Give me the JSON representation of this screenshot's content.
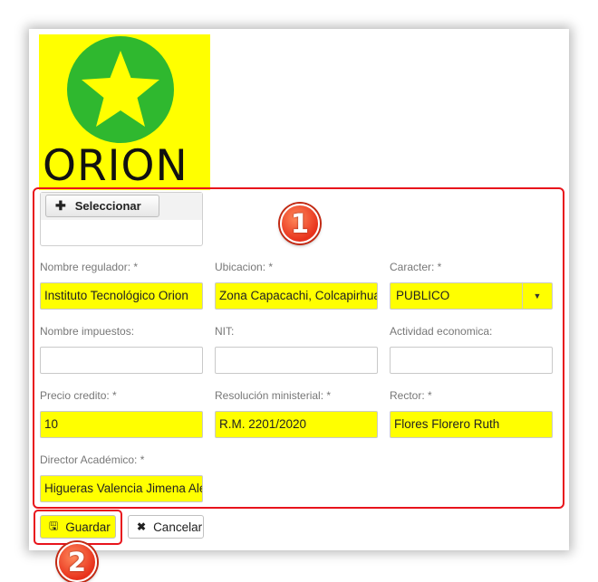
{
  "logo": {
    "text": "ORION",
    "icon": "star-icon",
    "bg_color": "#ffff00",
    "circle_color": "#2fb82f",
    "star_color": "#ffff00"
  },
  "upload": {
    "select_label": "Seleccionar",
    "icon": "plus-icon"
  },
  "annotations": {
    "badge1": "1",
    "badge2": "2",
    "highlight_color": "#e8141c"
  },
  "form": {
    "nombre_regulador": {
      "label": "Nombre regulador: *",
      "value": "Instituto Tecnológico Orion"
    },
    "ubicacion": {
      "label": "Ubicacion: *",
      "value": "Zona Capacachi, Colcapirhua"
    },
    "caracter": {
      "label": "Caracter: *",
      "value": "PUBLICO"
    },
    "nombre_impuestos": {
      "label": "Nombre impuestos:",
      "value": ""
    },
    "nit": {
      "label": "NIT:",
      "value": ""
    },
    "actividad_economica": {
      "label": "Actividad economica:",
      "value": ""
    },
    "precio_credito": {
      "label": "Precio credito: *",
      "value": "10"
    },
    "resolucion_ministerial": {
      "label": "Resolución ministerial: *",
      "value": "R.M. 2201/2020"
    },
    "rector": {
      "label": "Rector: *",
      "value": "Flores Florero Ruth"
    },
    "director_academico": {
      "label": "Director Académico: *",
      "value": "Higueras Valencia Jimena Alejandra"
    }
  },
  "actions": {
    "save_label": "Guardar",
    "save_icon": "floppy-disk-icon",
    "cancel_label": "Cancelar",
    "cancel_icon": "close-icon"
  }
}
